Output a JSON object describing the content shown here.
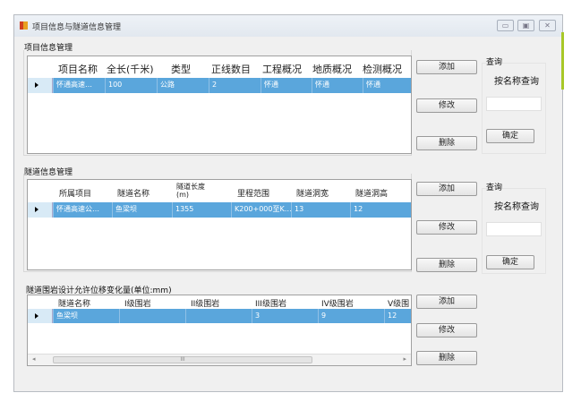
{
  "window": {
    "title": "项目信息与隧道信息管理",
    "minimize": "▭",
    "maximize": "▣",
    "close": "✕"
  },
  "project": {
    "title": "项目信息管理",
    "columns": [
      "项目名称",
      "全长(千米)",
      "类型",
      "正线数目",
      "工程概况",
      "地质概况",
      "检测概况"
    ],
    "row": [
      "怀通高速…",
      "100",
      "公路",
      "2",
      "怀通",
      "怀通",
      "怀通"
    ],
    "add": "添加",
    "edit": "修改",
    "delete": "删除",
    "query": {
      "title": "查询",
      "label": "按名称查询",
      "value": "",
      "confirm": "确定"
    }
  },
  "tunnel": {
    "title": "隧道信息管理",
    "columns": [
      "所属项目",
      "隧道名称",
      "隧道长度(m)",
      "里程范围",
      "隧道洞宽",
      "隧道洞高"
    ],
    "row": [
      "怀通高速公…",
      "鱼梁坝",
      "1355",
      "K200+000至K…",
      "13",
      "12"
    ],
    "add": "添加",
    "edit": "修改",
    "delete": "删除",
    "query": {
      "title": "查询",
      "label": "按名称查询",
      "value": "",
      "confirm": "确定"
    }
  },
  "rock": {
    "title": "隧道围岩设计允许位移变化量(单位:mm)",
    "columns": [
      "隧道名称",
      "I级围岩",
      "II级围岩",
      "III级围岩",
      "IV级围岩",
      "V级围"
    ],
    "row": [
      "鱼梁坝",
      "",
      "",
      "3",
      "9",
      "12"
    ],
    "add": "添加",
    "edit": "修改",
    "delete": "删除",
    "scroll_thumb": "III"
  }
}
